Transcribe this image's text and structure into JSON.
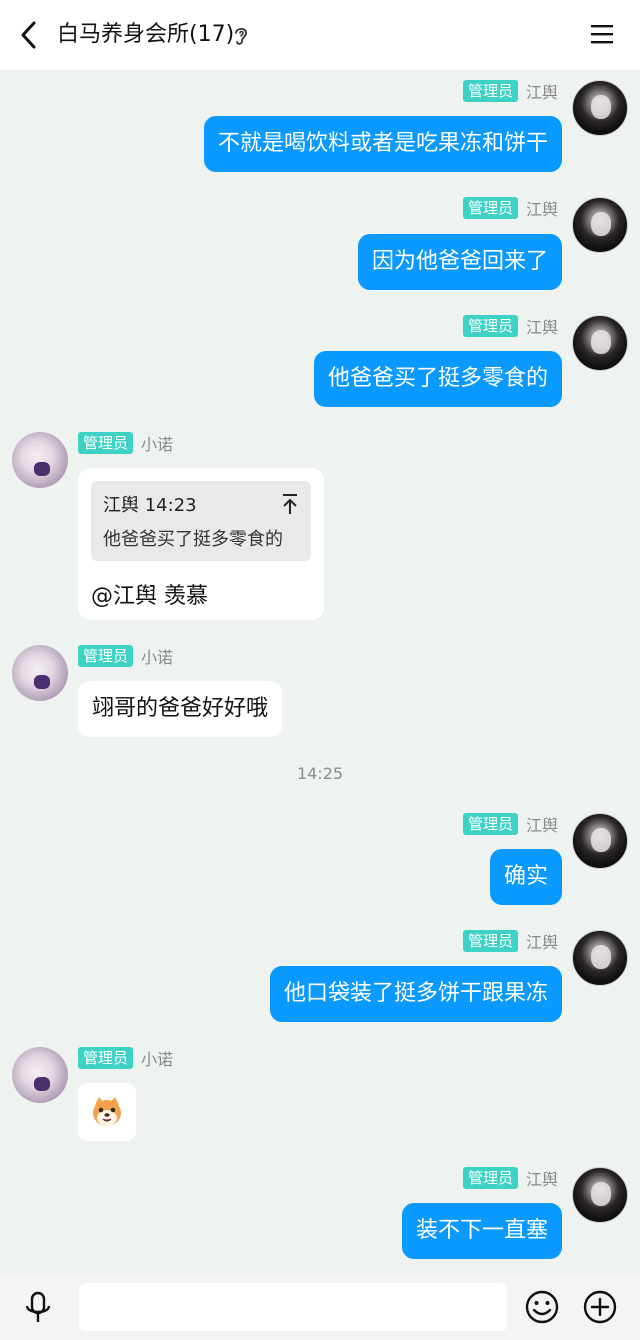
{
  "header": {
    "title": "白马养身会所(17)",
    "back_icon": "chevron-left-icon",
    "ear_icon": "ear-icon",
    "menu_icon": "hamburger-menu-icon"
  },
  "colors": {
    "my_bubble": "#0a99ff",
    "badge": "#3ed2c6",
    "background": "#eef3ef"
  },
  "messages": [
    {
      "sender": "江舆",
      "badge": "管理员",
      "text": "不就是喝饮料或者是吃果冻和饼干",
      "mine": true
    },
    {
      "sender": "江舆",
      "badge": "管理员",
      "text": "因为他爸爸回来了",
      "mine": true
    },
    {
      "sender": "江舆",
      "badge": "管理员",
      "text": "他爸爸买了挺多零食的",
      "mine": true
    },
    {
      "sender": "小诺",
      "badge": "管理员",
      "quote_header": "江舆 14:23",
      "quote_text": "他爸爸买了挺多零食的",
      "text": "@江舆 羡慕",
      "mine": false
    },
    {
      "sender": "小诺",
      "badge": "管理员",
      "text": "翊哥的爸爸好好哦",
      "mine": false
    },
    {
      "sender": "江舆",
      "badge": "管理员",
      "text": "确实",
      "mine": true
    },
    {
      "sender": "江舆",
      "badge": "管理员",
      "text": "他口袋装了挺多饼干跟果冻",
      "mine": true
    },
    {
      "sender": "小诺",
      "badge": "管理员",
      "sticker": "dog-face-sticker",
      "mine": false
    },
    {
      "sender": "江舆",
      "badge": "管理员",
      "text": "装不下一直塞",
      "mine": true
    }
  ],
  "time_separator": "14:25",
  "input_bar": {
    "placeholder": "",
    "mic_icon": "microphone-icon",
    "emoji_icon": "smiley-icon",
    "plus_icon": "plus-circle-icon"
  }
}
